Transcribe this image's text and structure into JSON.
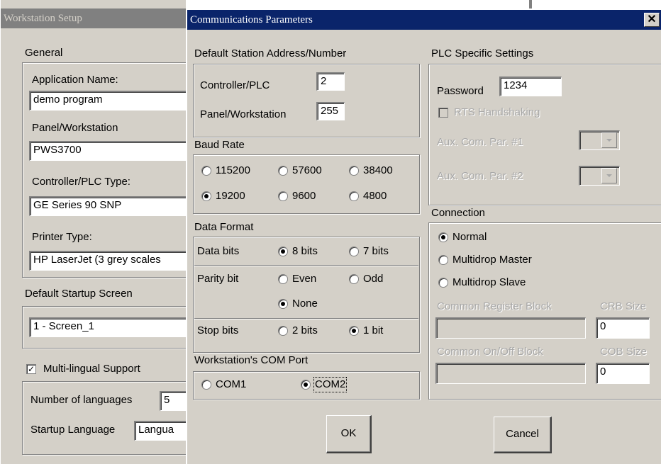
{
  "background_window": {
    "title": "Workstation Setup",
    "general": {
      "group_label": "General",
      "app_name_label": "Application Name:",
      "app_name_value": "demo program",
      "panel_label": "Panel/Workstation",
      "panel_value": "PWS3700",
      "plc_type_label": "Controller/PLC Type:",
      "plc_type_value": "GE Series 90 SNP",
      "printer_label": "Printer Type:",
      "printer_value": "HP LaserJet (3 grey scales"
    },
    "startup": {
      "group_label": "Default Startup Screen",
      "value": "1 - Screen_1"
    },
    "multilingual": {
      "label": "Multi-lingual Support",
      "checked": true,
      "num_label": "Number of languages",
      "num_value": "5",
      "startup_lang_label": "Startup Language",
      "startup_lang_value": "Langua"
    }
  },
  "dialog": {
    "title": "Communications Parameters",
    "close_glyph": "✕",
    "station": {
      "group_label": "Default Station Address/Number",
      "controller_label": "Controller/PLC",
      "controller_value": "2",
      "panel_label": "Panel/Workstation",
      "panel_value": "255"
    },
    "baud": {
      "group_label": "Baud Rate",
      "options": [
        "115200",
        "57600",
        "38400",
        "19200",
        "9600",
        "4800"
      ],
      "selected": "19200"
    },
    "data_format": {
      "group_label": "Data Format",
      "data_bits_label": "Data bits",
      "data_bits_options": [
        "8 bits",
        "7 bits"
      ],
      "data_bits_selected": "8 bits",
      "parity_label": "Parity bit",
      "parity_options": [
        "Even",
        "Odd",
        "None"
      ],
      "parity_selected": "None",
      "stop_bits_label": "Stop bits",
      "stop_bits_options": [
        "2 bits",
        "1 bit"
      ],
      "stop_bits_selected": "1 bit"
    },
    "com_port": {
      "group_label": "Workstation's COM Port",
      "options": [
        "COM1",
        "COM2"
      ],
      "selected": "COM2"
    },
    "plc_settings": {
      "group_label": "PLC Specific Settings",
      "password_label": "Password",
      "password_value": "1234",
      "rts_label": "RTS Handshaking",
      "aux1_label": "Aux. Com. Par. #1",
      "aux2_label": "Aux. Com. Par. #2"
    },
    "connection": {
      "group_label": "Connection",
      "options": [
        "Normal",
        "Multidrop Master",
        "Multidrop Slave"
      ],
      "selected": "Normal",
      "crb_label": "Common Register Block",
      "crb_size_label": "CRB Size",
      "crb_size_value": "0",
      "cob_label": "Common On/Off Block",
      "cob_size_label": "COB Size",
      "cob_size_value": "0"
    },
    "ok_label": "OK",
    "cancel_label": "Cancel"
  }
}
